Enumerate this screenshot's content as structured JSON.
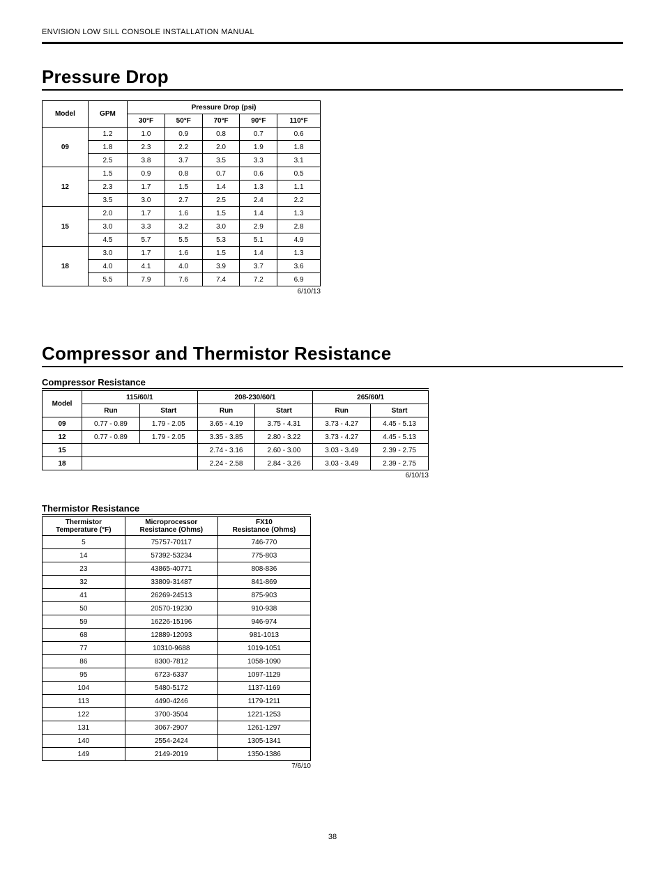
{
  "doc_header": "ENVISION LOW SILL CONSOLE INSTALLATION MANUAL",
  "page_number": "38",
  "pressure_drop": {
    "title": "Pressure Drop",
    "date": "6/10/13",
    "head": {
      "model": "Model",
      "gpm": "GPM",
      "group": "Pressure Drop (psi)",
      "cols": [
        "30°F",
        "50°F",
        "70°F",
        "90°F",
        "110°F"
      ]
    },
    "groups": [
      {
        "model": "09",
        "rows": [
          {
            "gpm": "1.2",
            "v": [
              "1.0",
              "0.9",
              "0.8",
              "0.7",
              "0.6"
            ]
          },
          {
            "gpm": "1.8",
            "v": [
              "2.3",
              "2.2",
              "2.0",
              "1.9",
              "1.8"
            ]
          },
          {
            "gpm": "2.5",
            "v": [
              "3.8",
              "3.7",
              "3.5",
              "3.3",
              "3.1"
            ]
          }
        ]
      },
      {
        "model": "12",
        "rows": [
          {
            "gpm": "1.5",
            "v": [
              "0.9",
              "0.8",
              "0.7",
              "0.6",
              "0.5"
            ]
          },
          {
            "gpm": "2.3",
            "v": [
              "1.7",
              "1.5",
              "1.4",
              "1.3",
              "1.1"
            ]
          },
          {
            "gpm": "3.5",
            "v": [
              "3.0",
              "2.7",
              "2.5",
              "2.4",
              "2.2"
            ]
          }
        ]
      },
      {
        "model": "15",
        "rows": [
          {
            "gpm": "2.0",
            "v": [
              "1.7",
              "1.6",
              "1.5",
              "1.4",
              "1.3"
            ]
          },
          {
            "gpm": "3.0",
            "v": [
              "3.3",
              "3.2",
              "3.0",
              "2.9",
              "2.8"
            ]
          },
          {
            "gpm": "4.5",
            "v": [
              "5.7",
              "5.5",
              "5.3",
              "5.1",
              "4.9"
            ]
          }
        ]
      },
      {
        "model": "18",
        "rows": [
          {
            "gpm": "3.0",
            "v": [
              "1.7",
              "1.6",
              "1.5",
              "1.4",
              "1.3"
            ]
          },
          {
            "gpm": "4.0",
            "v": [
              "4.1",
              "4.0",
              "3.9",
              "3.7",
              "3.6"
            ]
          },
          {
            "gpm": "5.5",
            "v": [
              "7.9",
              "7.6",
              "7.4",
              "7.2",
              "6.9"
            ]
          }
        ]
      }
    ]
  },
  "section2_title": "Compressor and Thermistor Resistance",
  "compressor": {
    "title": "Compressor Resistance",
    "date": "6/10/13",
    "head": {
      "model": "Model",
      "groups": [
        "115/60/1",
        "208-230/60/1",
        "265/60/1"
      ],
      "sub": [
        "Run",
        "Start"
      ]
    },
    "rows": [
      {
        "model": "09",
        "c": [
          "0.77 - 0.89",
          "1.79 - 2.05",
          "3.65 - 4.19",
          "3.75 - 4.31",
          "3.73 - 4.27",
          "4.45 - 5.13"
        ]
      },
      {
        "model": "12",
        "c": [
          "0.77 - 0.89",
          "1.79 - 2.05",
          "3.35 - 3.85",
          "2.80 - 3.22",
          "3.73 - 4.27",
          "4.45 - 5.13"
        ]
      },
      {
        "model": "15",
        "c": [
          "",
          "",
          "2.74 - 3.16",
          "2.60 - 3.00",
          "3.03 - 3.49",
          "2.39 - 2.75"
        ]
      },
      {
        "model": "18",
        "c": [
          "",
          "",
          "2.24 - 2.58",
          "2.84 - 3.26",
          "3.03 - 3.49",
          "2.39 - 2.75"
        ]
      }
    ]
  },
  "thermistor": {
    "title": "Thermistor Resistance",
    "date": "7/6/10",
    "head": [
      "Thermistor\nTemperature (°F)",
      "Microprocessor\nResistance (Ohms)",
      "FX10\nResistance (Ohms)"
    ],
    "rows": [
      [
        "5",
        "75757-70117",
        "746-770"
      ],
      [
        "14",
        "57392-53234",
        "775-803"
      ],
      [
        "23",
        "43865-40771",
        "808-836"
      ],
      [
        "32",
        "33809-31487",
        "841-869"
      ],
      [
        "41",
        "26269-24513",
        "875-903"
      ],
      [
        "50",
        "20570-19230",
        "910-938"
      ],
      [
        "59",
        "16226-15196",
        "946-974"
      ],
      [
        "68",
        "12889-12093",
        "981-1013"
      ],
      [
        "77",
        "10310-9688",
        "1019-1051"
      ],
      [
        "86",
        "8300-7812",
        "1058-1090"
      ],
      [
        "95",
        "6723-6337",
        "1097-1129"
      ],
      [
        "104",
        "5480-5172",
        "1137-1169"
      ],
      [
        "113",
        "4490-4246",
        "1179-1211"
      ],
      [
        "122",
        "3700-3504",
        "1221-1253"
      ],
      [
        "131",
        "3067-2907",
        "1261-1297"
      ],
      [
        "140",
        "2554-2424",
        "1305-1341"
      ],
      [
        "149",
        "2149-2019",
        "1350-1386"
      ]
    ]
  },
  "chart_data": [
    {
      "type": "table",
      "title": "Pressure Drop (psi)",
      "columns": [
        "Model",
        "GPM",
        "30°F",
        "50°F",
        "70°F",
        "90°F",
        "110°F"
      ],
      "rows": [
        [
          "09",
          "1.2",
          1.0,
          0.9,
          0.8,
          0.7,
          0.6
        ],
        [
          "09",
          "1.8",
          2.3,
          2.2,
          2.0,
          1.9,
          1.8
        ],
        [
          "09",
          "2.5",
          3.8,
          3.7,
          3.5,
          3.3,
          3.1
        ],
        [
          "12",
          "1.5",
          0.9,
          0.8,
          0.7,
          0.6,
          0.5
        ],
        [
          "12",
          "2.3",
          1.7,
          1.5,
          1.4,
          1.3,
          1.1
        ],
        [
          "12",
          "3.5",
          3.0,
          2.7,
          2.5,
          2.4,
          2.2
        ],
        [
          "15",
          "2.0",
          1.7,
          1.6,
          1.5,
          1.4,
          1.3
        ],
        [
          "15",
          "3.0",
          3.3,
          3.2,
          3.0,
          2.9,
          2.8
        ],
        [
          "15",
          "4.5",
          5.7,
          5.5,
          5.3,
          5.1,
          4.9
        ],
        [
          "18",
          "3.0",
          1.7,
          1.6,
          1.5,
          1.4,
          1.3
        ],
        [
          "18",
          "4.0",
          4.1,
          4.0,
          3.9,
          3.7,
          3.6
        ],
        [
          "18",
          "5.5",
          7.9,
          7.6,
          7.4,
          7.2,
          6.9
        ]
      ]
    },
    {
      "type": "table",
      "title": "Compressor Resistance",
      "columns": [
        "Model",
        "115/60/1 Run",
        "115/60/1 Start",
        "208-230/60/1 Run",
        "208-230/60/1 Start",
        "265/60/1 Run",
        "265/60/1 Start"
      ],
      "rows": [
        [
          "09",
          "0.77 - 0.89",
          "1.79 - 2.05",
          "3.65 - 4.19",
          "3.75 - 4.31",
          "3.73 - 4.27",
          "4.45 - 5.13"
        ],
        [
          "12",
          "0.77 - 0.89",
          "1.79 - 2.05",
          "3.35 - 3.85",
          "2.80 - 3.22",
          "3.73 - 4.27",
          "4.45 - 5.13"
        ],
        [
          "15",
          null,
          null,
          "2.74 - 3.16",
          "2.60 - 3.00",
          "3.03 - 3.49",
          "2.39 - 2.75"
        ],
        [
          "18",
          null,
          null,
          "2.24 - 2.58",
          "2.84 - 3.26",
          "3.03 - 3.49",
          "2.39 - 2.75"
        ]
      ]
    },
    {
      "type": "table",
      "title": "Thermistor Resistance",
      "columns": [
        "Thermistor Temperature (°F)",
        "Microprocessor Resistance (Ohms)",
        "FX10 Resistance (Ohms)"
      ],
      "rows": [
        [
          5,
          "75757-70117",
          "746-770"
        ],
        [
          14,
          "57392-53234",
          "775-803"
        ],
        [
          23,
          "43865-40771",
          "808-836"
        ],
        [
          32,
          "33809-31487",
          "841-869"
        ],
        [
          41,
          "26269-24513",
          "875-903"
        ],
        [
          50,
          "20570-19230",
          "910-938"
        ],
        [
          59,
          "16226-15196",
          "946-974"
        ],
        [
          68,
          "12889-12093",
          "981-1013"
        ],
        [
          77,
          "10310-9688",
          "1019-1051"
        ],
        [
          86,
          "8300-7812",
          "1058-1090"
        ],
        [
          95,
          "6723-6337",
          "1097-1129"
        ],
        [
          104,
          "5480-5172",
          "1137-1169"
        ],
        [
          113,
          "4490-4246",
          "1179-1211"
        ],
        [
          122,
          "3700-3504",
          "1221-1253"
        ],
        [
          131,
          "3067-2907",
          "1261-1297"
        ],
        [
          140,
          "2554-2424",
          "1305-1341"
        ],
        [
          149,
          "2149-2019",
          "1350-1386"
        ]
      ]
    }
  ]
}
